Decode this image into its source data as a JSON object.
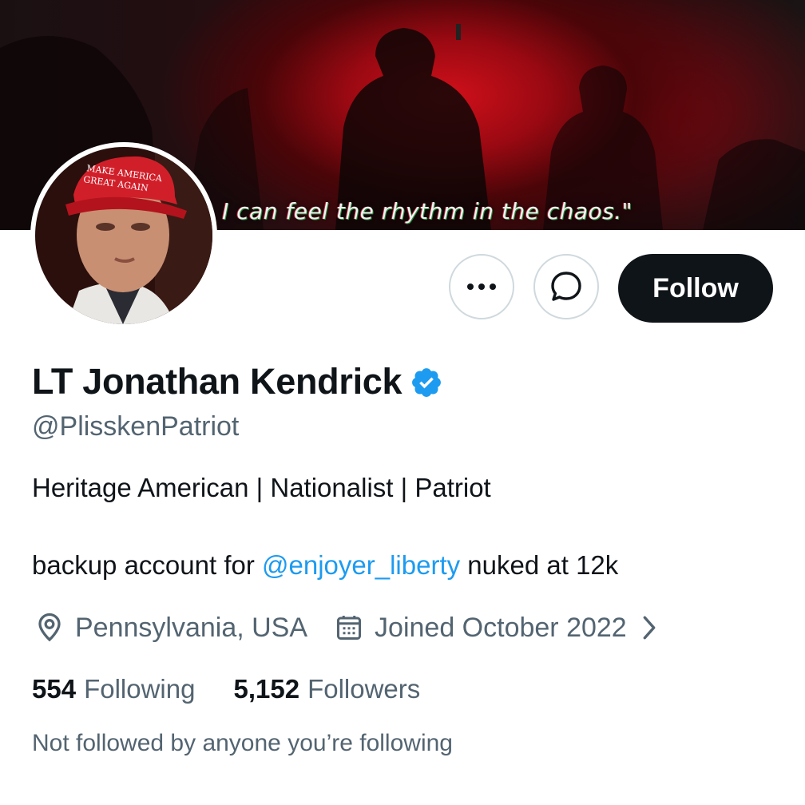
{
  "banner": {
    "quote": "I can feel the rhythm in the chaos.\""
  },
  "avatar": {
    "hat_text_line1": "MAKE AMERICA",
    "hat_text_line2": "GREAT AGAIN"
  },
  "actions": {
    "more_icon": "more-dots-icon",
    "message_icon": "message-bubble-icon",
    "follow_label": "Follow"
  },
  "profile": {
    "display_name": "LT Jonathan Kendrick",
    "handle": "@PlisskenPatriot",
    "verified": true,
    "bio_line1": "Heritage American | Nationalist | Patriot",
    "bio_line2_prefix": "backup account for ",
    "bio_line2_mention": "@enjoyer_liberty",
    "bio_line2_suffix": " nuked at 12k",
    "location": "Pennsylvania, USA",
    "joined": "Joined October 2022"
  },
  "stats": {
    "following_count": "554",
    "following_label": "Following",
    "followers_count": "5,152",
    "followers_label": "Followers"
  },
  "social_context": "Not followed by anyone you’re following",
  "colors": {
    "accent": "#1d9bf0",
    "text": "#0f1419",
    "secondary": "#536471",
    "border": "#cfd9de"
  }
}
